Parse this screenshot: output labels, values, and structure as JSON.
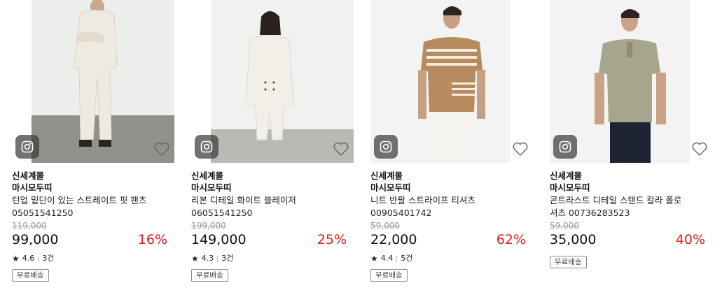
{
  "products": [
    {
      "brand": "신세계몰",
      "seller": "마시모두띠",
      "name": "턴업 밑단이 있는 스트레이트 핏 팬츠 05051541250",
      "original_price": "119,000",
      "price": "99,000",
      "discount": "16%",
      "rating": "4.6",
      "reviews": "3건",
      "badge": "무료배송",
      "background": "#eceeec",
      "floor": "#8f918b",
      "outfit_color": "#efeae0"
    },
    {
      "brand": "신세계몰",
      "seller": "마시모두띠",
      "name": "리본 디테일 화이트 블레이저 06051541250",
      "original_price": "199,000",
      "price": "149,000",
      "discount": "25%",
      "rating": "4.3",
      "reviews": "3건",
      "badge": "무료배송",
      "background": "#f1f1ef",
      "floor": "#b9bab4",
      "outfit_color": "#f2efe8"
    },
    {
      "brand": "신세계몰",
      "seller": "마시모두띠",
      "name": "니트 반팔 스트라이프 티셔츠 00905401742",
      "original_price": "59,000",
      "price": "22,000",
      "discount": "62%",
      "rating": "4.4",
      "reviews": "5건",
      "badge": "무료배송",
      "background": "#f3f3f3",
      "floor": "#f3f3f3",
      "outfit_color": "#b78b5e"
    },
    {
      "brand": "신세계몰",
      "seller": "마시모두띠",
      "name": "콘트라스트 디테일 스탠드 칼라 폴로 셔츠 00736283523",
      "original_price": "59,000",
      "price": "35,000",
      "discount": "40%",
      "rating": "",
      "reviews": "",
      "badge": "무료배송",
      "background": "#f3f3f3",
      "floor": "#f3f3f3",
      "outfit_color": "#a7a58c"
    }
  ],
  "icons": {
    "instagram": "instagram-icon",
    "wishlist": "heart-outline-icon",
    "rating": "star-icon"
  },
  "colors": {
    "discount": "#e02020",
    "original_price": "#999999"
  }
}
